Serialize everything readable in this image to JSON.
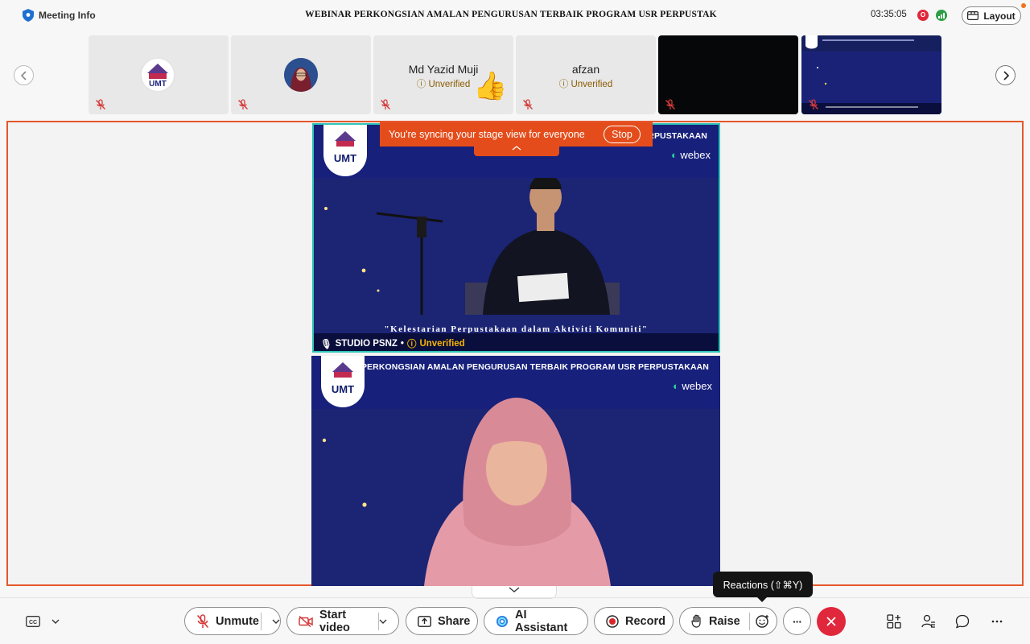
{
  "header": {
    "meeting_info_label": "Meeting Info",
    "window_title": "WEBINAR PERKONGSIAN AMALAN PENGURUSAN TERBAIK PROGRAM USR PERPUSTAK",
    "timer": "03:35:05",
    "rec_badge": "O",
    "layout_label": "Layout"
  },
  "thumbnails": [
    {
      "name": "",
      "status": ""
    },
    {
      "name": "",
      "status": ""
    },
    {
      "name": "Md Yazid Muji",
      "status": "Unverified"
    },
    {
      "name": "afzan",
      "status": "Unverified"
    },
    {
      "name": "",
      "status": ""
    },
    {
      "name": "",
      "status": ""
    }
  ],
  "stage": {
    "sync_message": "You're syncing your stage view for everyone",
    "stop_label": "Stop",
    "video1": {
      "header_text": "PERPUSTAKAAN",
      "webex_label": "webex",
      "logo_text": "UMT",
      "caption": "\"Kelestarian Perpustakaan dalam Aktiviti Komuniti\"",
      "participant_name": "STUDIO PSNZ",
      "participant_status": "Unverified"
    },
    "video2": {
      "header_text": "PERKONGSIAN AMALAN PENGURUSAN TERBAIK  PROGRAM USR PERPUSTAKAAN",
      "webex_label": "webex",
      "logo_text": "UMT"
    }
  },
  "toolbar": {
    "unmute_label": "Unmute",
    "start_video_label": "Start video",
    "share_label": "Share",
    "ai_assistant_label": "AI Assistant",
    "record_label": "Record",
    "raise_label": "Raise",
    "reactions_tooltip": "Reactions (⇧⌘Y)",
    "more_label": "···"
  },
  "colors": {
    "accent_orange": "#e44d1b",
    "end_red": "#e0273b",
    "video_blue": "#1c2474"
  }
}
